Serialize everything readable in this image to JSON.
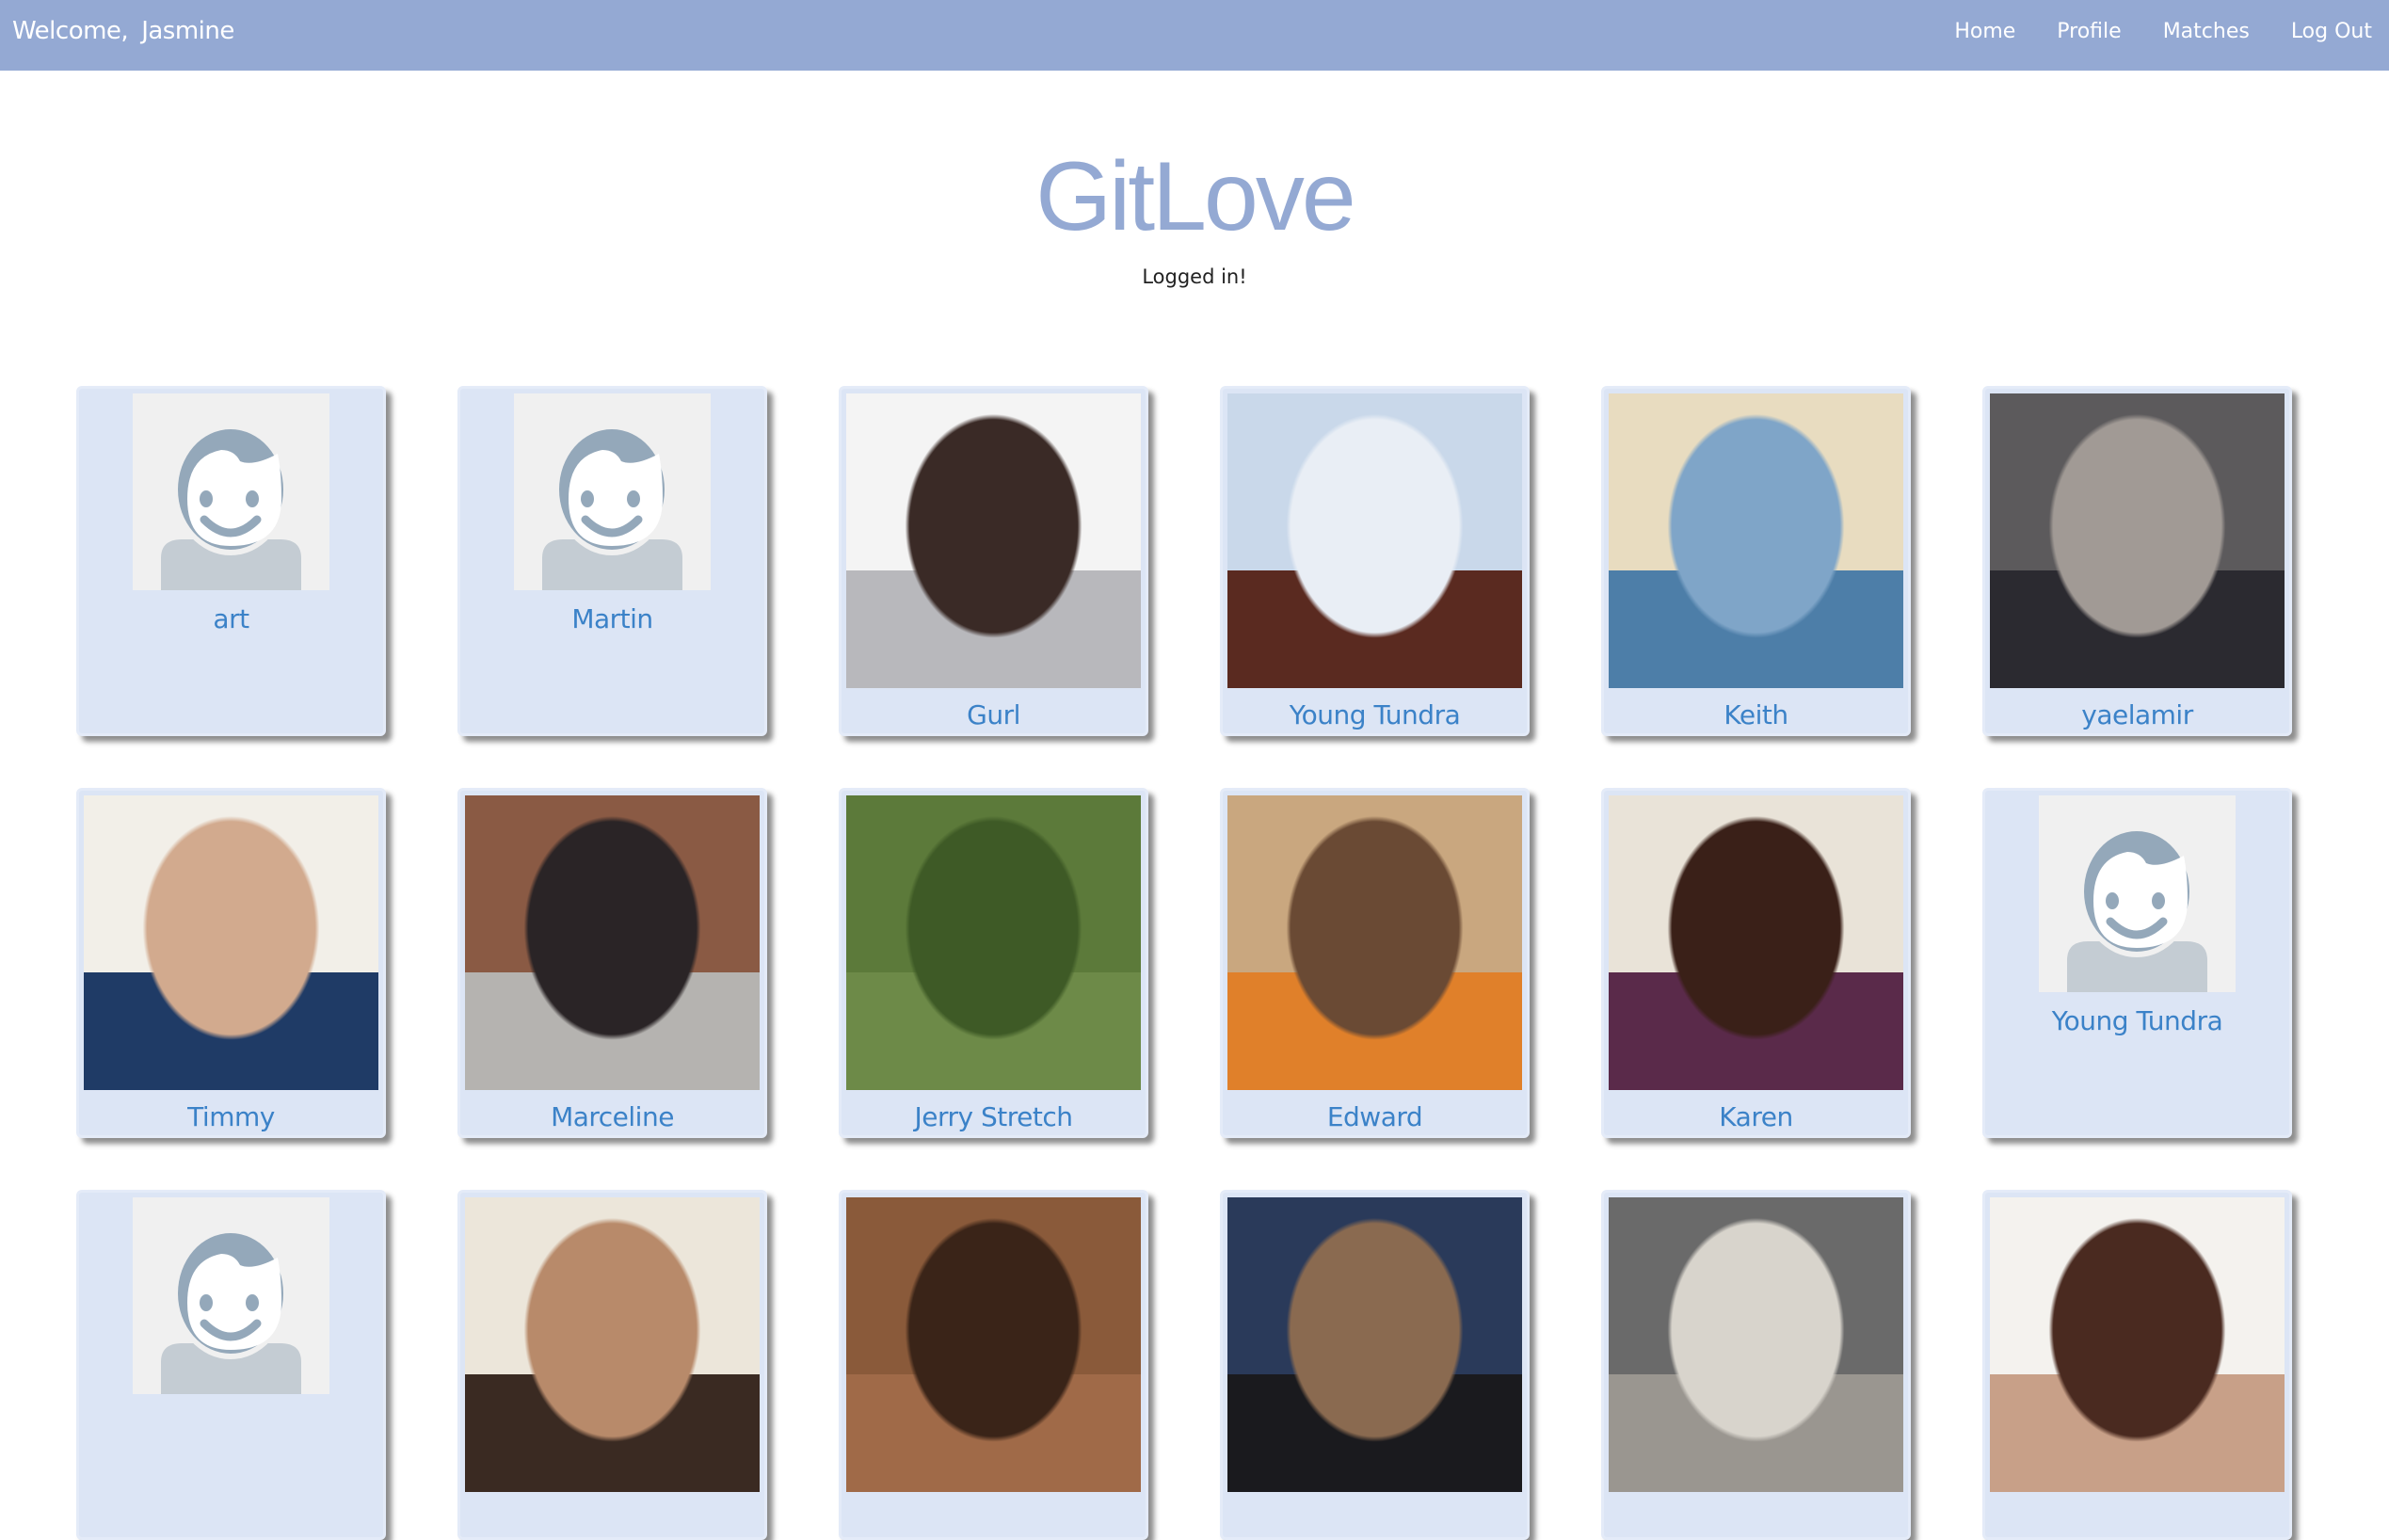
{
  "nav": {
    "welcome_label": "Welcome,",
    "user": "Jasmine",
    "links": [
      "Home",
      "Profile",
      "Matches",
      "Log Out"
    ]
  },
  "header": {
    "title": "GitLove",
    "status": "Logged in!"
  },
  "colors": {
    "nav": "#94a9d3",
    "card": "#dce5f5",
    "name": "#3b82c8",
    "avatar": "#94a8ba"
  },
  "cards": [
    {
      "name": "art",
      "type": "default"
    },
    {
      "name": "Martin",
      "type": "default"
    },
    {
      "name": "Gurl",
      "type": "photo",
      "colors": [
        "#f4f4f4",
        "#3a2a26",
        "#b8b8bc"
      ]
    },
    {
      "name": "Young Tundra",
      "type": "photo",
      "colors": [
        "#c9d8ea",
        "#e9eef5",
        "#5a2a20"
      ]
    },
    {
      "name": "Keith",
      "type": "photo",
      "colors": [
        "#e8dcc0",
        "#7fa5c8",
        "#4d7ea8"
      ]
    },
    {
      "name": "yaelamir",
      "type": "photo",
      "colors": [
        "#5c5a5c",
        "#a19a95",
        "#2b2a30"
      ]
    },
    {
      "name": "Timmy",
      "type": "photo",
      "colors": [
        "#f2efe8",
        "#d2aa8e",
        "#1f3b66"
      ]
    },
    {
      "name": "Marceline",
      "type": "photo",
      "colors": [
        "#8a5a44",
        "#2a2426",
        "#b5b3b0"
      ]
    },
    {
      "name": "Jerry Stretch",
      "type": "photo",
      "colors": [
        "#5c7a3a",
        "#3e5a26",
        "#6d8a48"
      ]
    },
    {
      "name": "Edward",
      "type": "photo",
      "colors": [
        "#c9a77f",
        "#6a4a34",
        "#e0802a"
      ]
    },
    {
      "name": "Karen",
      "type": "photo",
      "colors": [
        "#e9e3d8",
        "#3a2018",
        "#5a2a4a"
      ]
    },
    {
      "name": "Young Tundra",
      "type": "default"
    },
    {
      "name": "",
      "type": "default"
    },
    {
      "name": "",
      "type": "photo",
      "colors": [
        "#ece6da",
        "#b88a6a",
        "#3a2a22"
      ]
    },
    {
      "name": "",
      "type": "photo",
      "colors": [
        "#8a5a3a",
        "#3a2418",
        "#a06a48"
      ]
    },
    {
      "name": "",
      "type": "photo",
      "colors": [
        "#2a3a5a",
        "#8a6a50",
        "#1a1a1e"
      ]
    },
    {
      "name": "",
      "type": "photo",
      "colors": [
        "#6a6a6a",
        "#d8d4cc",
        "#9a9690"
      ]
    },
    {
      "name": "",
      "type": "photo",
      "colors": [
        "#f4f2ee",
        "#4a2a20",
        "#c8a088"
      ]
    }
  ]
}
